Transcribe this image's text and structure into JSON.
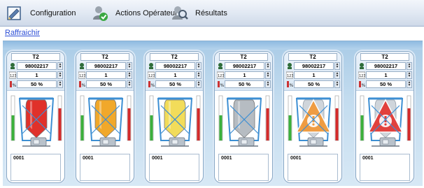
{
  "toolbar": {
    "tabs": [
      {
        "label": "Configuration",
        "icon": "configuration-icon"
      },
      {
        "label": "Actions Opérateur",
        "icon": "operator-actions-icon"
      },
      {
        "label": "Résultats",
        "icon": "results-search-icon"
      }
    ]
  },
  "refresh": {
    "label": "Raffraichir"
  },
  "tanks": [
    {
      "name": "T2",
      "id": "98002217",
      "count": "1",
      "percent": "50 %",
      "note": "0001",
      "state": "red",
      "fill": "#e0312a"
    },
    {
      "name": "T2",
      "id": "98002217",
      "count": "1",
      "percent": "50 %",
      "note": "0001",
      "state": "orange",
      "fill": "#f1a82a"
    },
    {
      "name": "T2",
      "id": "98002217",
      "count": "1",
      "percent": "50 %",
      "note": "0001",
      "state": "yellow",
      "fill": "#f2dc5a"
    },
    {
      "name": "T2",
      "id": "98002217",
      "count": "1",
      "percent": "50 %",
      "note": "0001",
      "state": "grey",
      "fill": "#b6bcc2"
    },
    {
      "name": "T2",
      "id": "98002217",
      "count": "1",
      "percent": "50 %",
      "note": "0001",
      "state": "warning-orange",
      "fill": "#f19a3a"
    },
    {
      "name": "T2",
      "id": "98002217",
      "count": "1",
      "percent": "50 %",
      "note": "0001",
      "state": "warning-red",
      "fill": "#e23a35"
    }
  ],
  "colors": {
    "gauge_green": "#3bb03b",
    "gauge_red": "#d42a2a",
    "frame_blue": "#3d8fd3"
  }
}
